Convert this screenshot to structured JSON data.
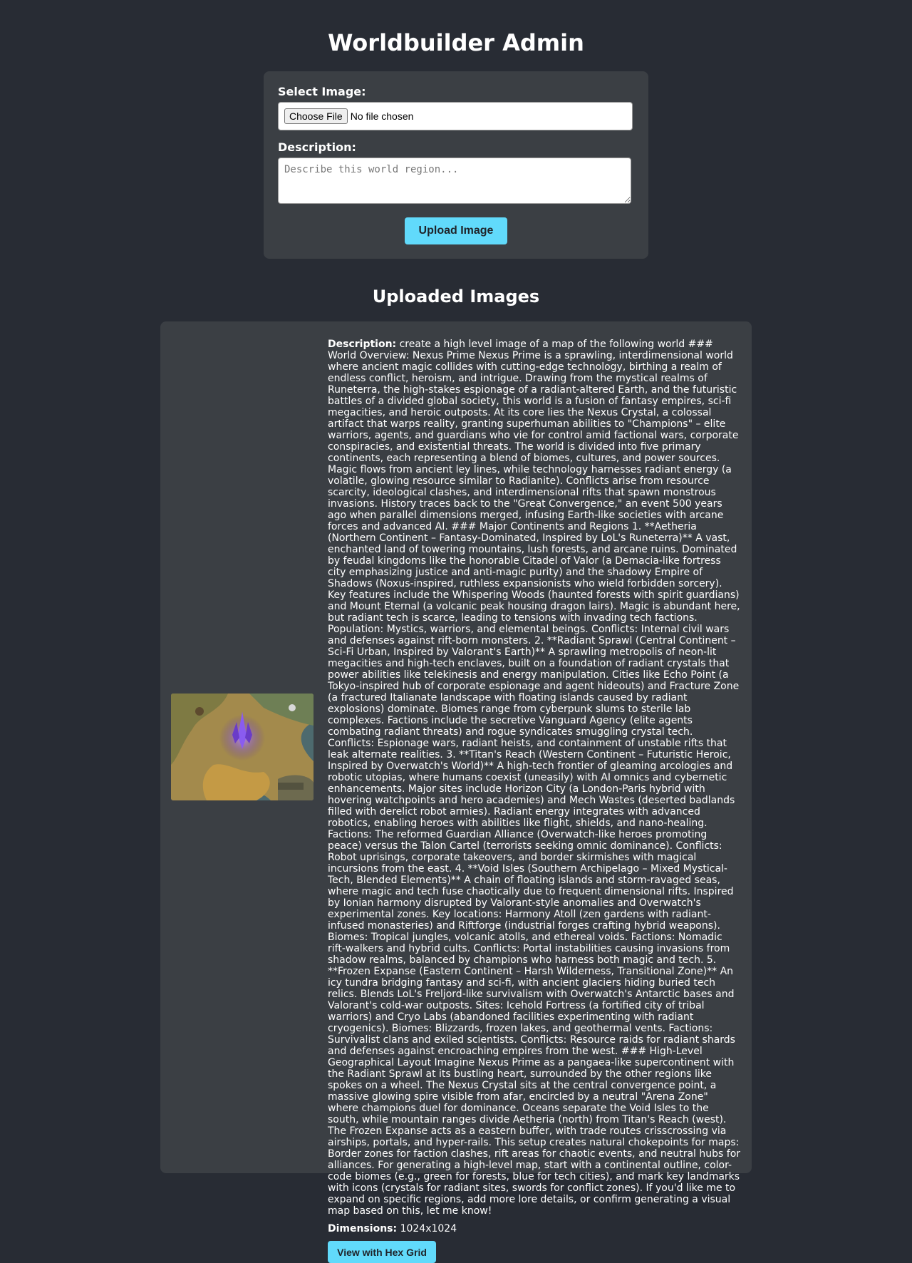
{
  "page": {
    "title": "Worldbuilder Admin"
  },
  "upload_form": {
    "select_label": "Select Image:",
    "file_button_label": "Choose File",
    "file_status": "No file chosen",
    "description_label": "Description:",
    "description_placeholder": "Describe this world region...",
    "upload_button_label": "Upload Image"
  },
  "gallery": {
    "title": "Uploaded Images",
    "items": [
      {
        "thumbnail_icon": "fantasy-world-map-thumbnail",
        "description_label": "Description:",
        "description": "create a high level image of a map of the following world ### World Overview: Nexus Prime Nexus Prime is a sprawling, interdimensional world where ancient magic collides with cutting-edge technology, birthing a realm of endless conflict, heroism, and intrigue. Drawing from the mystical realms of Runeterra, the high-stakes espionage of a radiant-altered Earth, and the futuristic battles of a divided global society, this world is a fusion of fantasy empires, sci-fi megacities, and heroic outposts. At its core lies the Nexus Crystal, a colossal artifact that warps reality, granting superhuman abilities to \"Champions\" – elite warriors, agents, and guardians who vie for control amid factional wars, corporate conspiracies, and existential threats. The world is divided into five primary continents, each representing a blend of biomes, cultures, and power sources. Magic flows from ancient ley lines, while technology harnesses radiant energy (a volatile, glowing resource similar to Radianite). Conflicts arise from resource scarcity, ideological clashes, and interdimensional rifts that spawn monstrous invasions. History traces back to the \"Great Convergence,\" an event 500 years ago when parallel dimensions merged, infusing Earth-like societies with arcane forces and advanced AI. ### Major Continents and Regions 1. **Aetheria (Northern Continent – Fantasy-Dominated, Inspired by LoL's Runeterra)** A vast, enchanted land of towering mountains, lush forests, and arcane ruins. Dominated by feudal kingdoms like the honorable Citadel of Valor (a Demacia-like fortress city emphasizing justice and anti-magic purity) and the shadowy Empire of Shadows (Noxus-inspired, ruthless expansionists who wield forbidden sorcery). Key features include the Whispering Woods (haunted forests with spirit guardians) and Mount Eternal (a volcanic peak housing dragon lairs). Magic is abundant here, but radiant tech is scarce, leading to tensions with invading tech factions. Population: Mystics, warriors, and elemental beings. Conflicts: Internal civil wars and defenses against rift-born monsters. 2. **Radiant Sprawl (Central Continent – Sci-Fi Urban, Inspired by Valorant's Earth)** A sprawling metropolis of neon-lit megacities and high-tech enclaves, built on a foundation of radiant crystals that power abilities like telekinesis and energy manipulation. Cities like Echo Point (a Tokyo-inspired hub of corporate espionage and agent hideouts) and Fracture Zone (a fractured Italianate landscape with floating islands caused by radiant explosions) dominate. Biomes range from cyberpunk slums to sterile lab complexes. Factions include the secretive Vanguard Agency (elite agents combating radiant threats) and rogue syndicates smuggling crystal tech. Conflicts: Espionage wars, radiant heists, and containment of unstable rifts that leak alternate realities. 3. **Titan's Reach (Western Continent – Futuristic Heroic, Inspired by Overwatch's World)** A high-tech frontier of gleaming arcologies and robotic utopias, where humans coexist (uneasily) with AI omnics and cybernetic enhancements. Major sites include Horizon City (a London-Paris hybrid with hovering watchpoints and hero academies) and Mech Wastes (deserted badlands filled with derelict robot armies). Radiant energy integrates with advanced robotics, enabling heroes with abilities like flight, shields, and nano-healing. Factions: The reformed Guardian Alliance (Overwatch-like heroes promoting peace) versus the Talon Cartel (terrorists seeking omnic dominance). Conflicts: Robot uprisings, corporate takeovers, and border skirmishes with magical incursions from the east. 4. **Void Isles (Southern Archipelago – Mixed Mystical-Tech, Blended Elements)** A chain of floating islands and storm-ravaged seas, where magic and tech fuse chaotically due to frequent dimensional rifts. Inspired by Ionian harmony disrupted by Valorant-style anomalies and Overwatch's experimental zones. Key locations: Harmony Atoll (zen gardens with radiant-infused monasteries) and Riftforge (industrial forges crafting hybrid weapons). Biomes: Tropical jungles, volcanic atolls, and ethereal voids. Factions: Nomadic rift-walkers and hybrid cults. Conflicts: Portal instabilities causing invasions from shadow realms, balanced by champions who harness both magic and tech. 5. **Frozen Expanse (Eastern Continent – Harsh Wilderness, Transitional Zone)** An icy tundra bridging fantasy and sci-fi, with ancient glaciers hiding buried tech relics. Blends LoL's Freljord-like survivalism with Overwatch's Antarctic bases and Valorant's cold-war outposts. Sites: Icehold Fortress (a fortified city of tribal warriors) and Cryo Labs (abandoned facilities experimenting with radiant cryogenics). Biomes: Blizzards, frozen lakes, and geothermal vents. Factions: Survivalist clans and exiled scientists. Conflicts: Resource raids for radiant shards and defenses against encroaching empires from the west. ### High-Level Geographical Layout Imagine Nexus Prime as a pangaea-like supercontinent with the Radiant Sprawl at its bustling heart, surrounded by the other regions like spokes on a wheel. The Nexus Crystal sits at the central convergence point, a massive glowing spire visible from afar, encircled by a neutral \"Arena Zone\" where champions duel for dominance. Oceans separate the Void Isles to the south, while mountain ranges divide Aetheria (north) from Titan's Reach (west). The Frozen Expanse acts as a eastern buffer, with trade routes crisscrossing via airships, portals, and hyper-rails. This setup creates natural chokepoints for maps: Border zones for faction clashes, rift areas for chaotic events, and neutral hubs for alliances. For generating a high-level map, start with a continental outline, color-code biomes (e.g., green for forests, blue for tech cities), and mark key landmarks with icons (crystals for radiant sites, swords for conflict zones). If you'd like me to expand on specific regions, add more lore details, or confirm generating a visual map based on this, let me know!",
        "dimensions_label": "Dimensions:",
        "dimensions": "1024x1024",
        "hex_button_label": "View with Hex Grid"
      }
    ]
  },
  "colors": {
    "background": "#282c34",
    "card": "#3b3f44",
    "accent": "#61dafb"
  }
}
